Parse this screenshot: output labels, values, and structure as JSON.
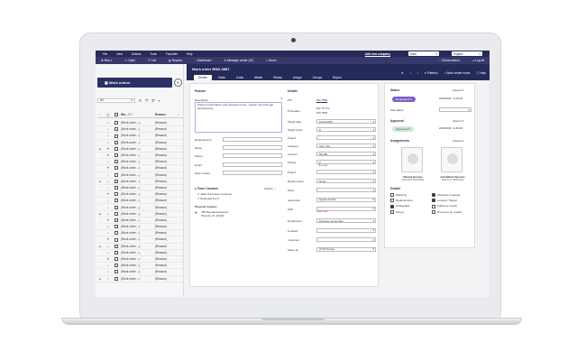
{
  "menu": {
    "items": [
      "File",
      "View",
      "Actions",
      "Tools",
      "Favorites",
      "Help"
    ],
    "add_company": "Add new company",
    "company_select": "Mark",
    "language_select": "English"
  },
  "toolbar": {
    "items": [
      "New",
      "Open",
      "List",
      "Reports",
      "Dashboard",
      "Message center (10)",
      "Home"
    ],
    "global_search": "Global search",
    "logout": "Log off"
  },
  "left": {
    "work_orders_btn": "Work orders",
    "filter_value": "All",
    "col_wo": "Wo...",
    "col_reason": "Reason",
    "rows": [
      {
        "wo": "(Work order ...)",
        "reason": "(Reason)"
      },
      {
        "wo": "(Work order ...)",
        "reason": "(Reason)"
      },
      {
        "wo": "(Work order ...)",
        "reason": "(Reason)"
      },
      {
        "wo": "(Work order ...)",
        "reason": "(Reason)"
      },
      {
        "wo": "(Work order ...)",
        "reason": "(Reason)"
      },
      {
        "wo": "(Work order ...)",
        "reason": "(Reason)"
      },
      {
        "wo": "(Work order ...)",
        "reason": "(Reason)"
      },
      {
        "wo": "(Work order ...)",
        "reason": "(Reason)"
      },
      {
        "wo": "(Work order ...)",
        "reason": "(Reason)"
      },
      {
        "wo": "(Work order ...)",
        "reason": "(Reason)"
      },
      {
        "wo": "(Work order ...)",
        "reason": "(Reason)"
      },
      {
        "wo": "(Work order ...)",
        "reason": "(Reason)"
      },
      {
        "wo": "(Work order ...)",
        "reason": "(Reason)"
      },
      {
        "wo": "(Work order ...)",
        "reason": "(Reason)"
      },
      {
        "wo": "(Work order ...)",
        "reason": "(Reason)"
      },
      {
        "wo": "(Work order ...)",
        "reason": "(Reason)"
      },
      {
        "wo": "(Work order ...)",
        "reason": "(Reason)"
      },
      {
        "wo": "(Work order ...)",
        "reason": "(Reason)"
      },
      {
        "wo": "(Work order ...)",
        "reason": "(Reason)"
      },
      {
        "wo": "(Work order ...)",
        "reason": "(Reason)"
      },
      {
        "wo": "(Work order ...)",
        "reason": "(Reason)"
      },
      {
        "wo": "(Work order ...)",
        "reason": "(Reason)"
      },
      {
        "wo": "(Work order ...)",
        "reason": "(Reason)"
      },
      {
        "wo": "(Work order ...)",
        "reason": "(Reason)"
      },
      {
        "wo": "(Work order ...)",
        "reason": "(Reason)"
      }
    ]
  },
  "header": {
    "title": "Work order RNG-0987",
    "tabs": [
      "Details",
      "Tasks",
      "Costs",
      "Attach",
      "History",
      "Assign",
      "Groups",
      "Report"
    ],
    "refresh": "Refresh",
    "home": "Work center home",
    "help": "Help"
  },
  "reason": {
    "section": "Reason",
    "desc_label": "Description",
    "desc_value": "Pump is intermittent, and pressure is low - suction input line got punctured by",
    "fields": [
      {
        "label": "Requested Of",
        "value": ""
      },
      {
        "label": "Name",
        "value": ""
      },
      {
        "label": "Phone",
        "value": ""
      },
      {
        "label": "Email",
        "value": ""
      },
      {
        "label": "Open reason",
        "value": ""
      }
    ],
    "team_label": "Team / location",
    "actions": "Actions",
    "team_items": [
      "Table the Future company",
      "Extended line 5"
    ],
    "phys_label": "Physical location",
    "address_1": "795 Rensboral Avenue",
    "address_2": "Phoenix, FL 22426"
  },
  "details": {
    "section": "Details",
    "pm_label": "PM",
    "pm_value": "PM 7558",
    "proc_label": "Procedure",
    "proc_value_1": "MC-75 Pro",
    "proc_value_2": "PM 7528",
    "fields": [
      {
        "label": "Target date",
        "value": "12/11/2026"
      },
      {
        "label": "Target hours",
        "value": "8"
      },
      {
        "label": "Project",
        "value": ""
      },
      {
        "label": "Category",
        "value": "Test 1 lbl"
      },
      {
        "label": "Account",
        "value": "58 290"
      },
      {
        "label": "Priority",
        "value": "2"
      }
    ],
    "priority_note": "Normal",
    "fields2": [
      {
        "label": "Project",
        "value": ""
      },
      {
        "label": "Repair center",
        "value": "None"
      },
      {
        "label": "Shop",
        "value": ""
      },
      {
        "label": "Supervisor",
        "value": "Queue Anand"
      },
      {
        "label": "Shift",
        "value": ""
      }
    ],
    "shift_note": "Select shift",
    "fields3": [
      {
        "label": "Department",
        "value": "Pressure pump lane"
      },
      {
        "label": "Contract",
        "value": ""
      },
      {
        "label": "Customer",
        "value": ""
      },
      {
        "label": "Taken by",
        "value": "Chris Treace"
      }
    ]
  },
  "right": {
    "status_label": "Status",
    "actions": "Actions",
    "requested": "Requested",
    "req_date": "2023/05/08 - 11:48 AM",
    "substatus_label": "Sub-status",
    "approval_label": "Approval",
    "approved": "Approved",
    "app_date": "2023/05/08 - 11:48 AM",
    "assign_label": "Assignments",
    "person1": "Tatiana Kennys",
    "person1_meta": "Tech 3 | 0 | 8.5 hours",
    "person2": "Johnathan Sponen",
    "person2_meta": "Tech 2 | 0 | 8.5 hours",
    "details_label": "Details",
    "checks": [
      {
        "label": "Warranty",
        "on": false
      },
      {
        "label": "Shutdown required",
        "on": true
      },
      {
        "label": "Requirements",
        "on": false
      },
      {
        "label": "Lockout / Tagout",
        "on": true
      },
      {
        "label": "Chargeable",
        "on": true
      },
      {
        "label": "Follow up needs",
        "on": false
      },
      {
        "label": "Survey",
        "on": false
      },
      {
        "label": "Prompt to be mailed",
        "on": false
      }
    ]
  },
  "colors": {
    "navy": "#262a58",
    "toolbar": "#35396c",
    "accent": "#7b61c9",
    "approved": "#cfe9d6"
  }
}
